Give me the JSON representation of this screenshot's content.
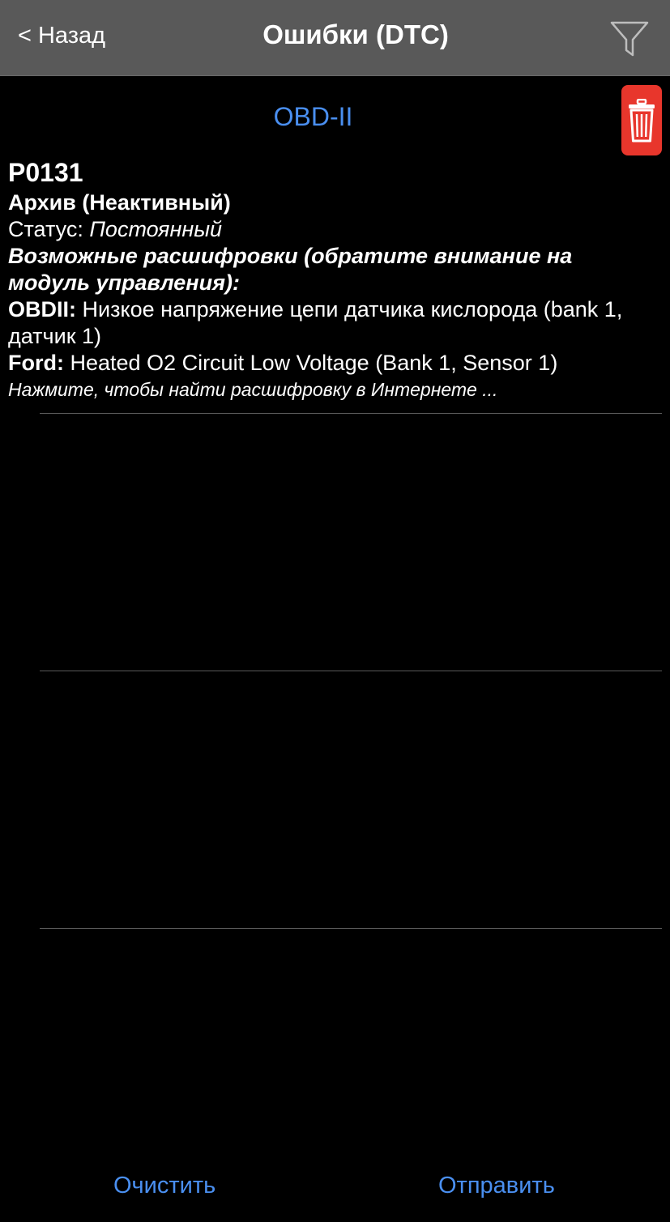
{
  "nav": {
    "back_label": "< Назад",
    "title": "Ошибки (DTC)",
    "filter_icon": "filter-funnel-icon"
  },
  "section": {
    "header": "OBD-II",
    "delete_icon": "trash-icon",
    "delete_color": "#e8362c"
  },
  "dtc": {
    "code": "P0131",
    "state": "Архив (Неактивный)",
    "status_label": "Статус: ",
    "status_value": "Постоянный",
    "decodings_title": "Возможные расшифровки (обратите внимание на модуль управления):",
    "obd_label": "OBDII:",
    "obd_text": " Низкое напряжение цепи датчика кислорода (bank 1, датчик 1)",
    "ford_label": "Ford:",
    "ford_text": " Heated O2 Circuit Low Voltage (Bank 1, Sensor 1)",
    "search_hint": "Нажмите, чтобы найти расшифровку в Интернете ..."
  },
  "toolbar": {
    "clear_label": "Очистить",
    "send_label": "Отправить"
  },
  "colors": {
    "accent": "#4a8ff0",
    "navbar_bg": "#595959",
    "background": "#000000"
  }
}
